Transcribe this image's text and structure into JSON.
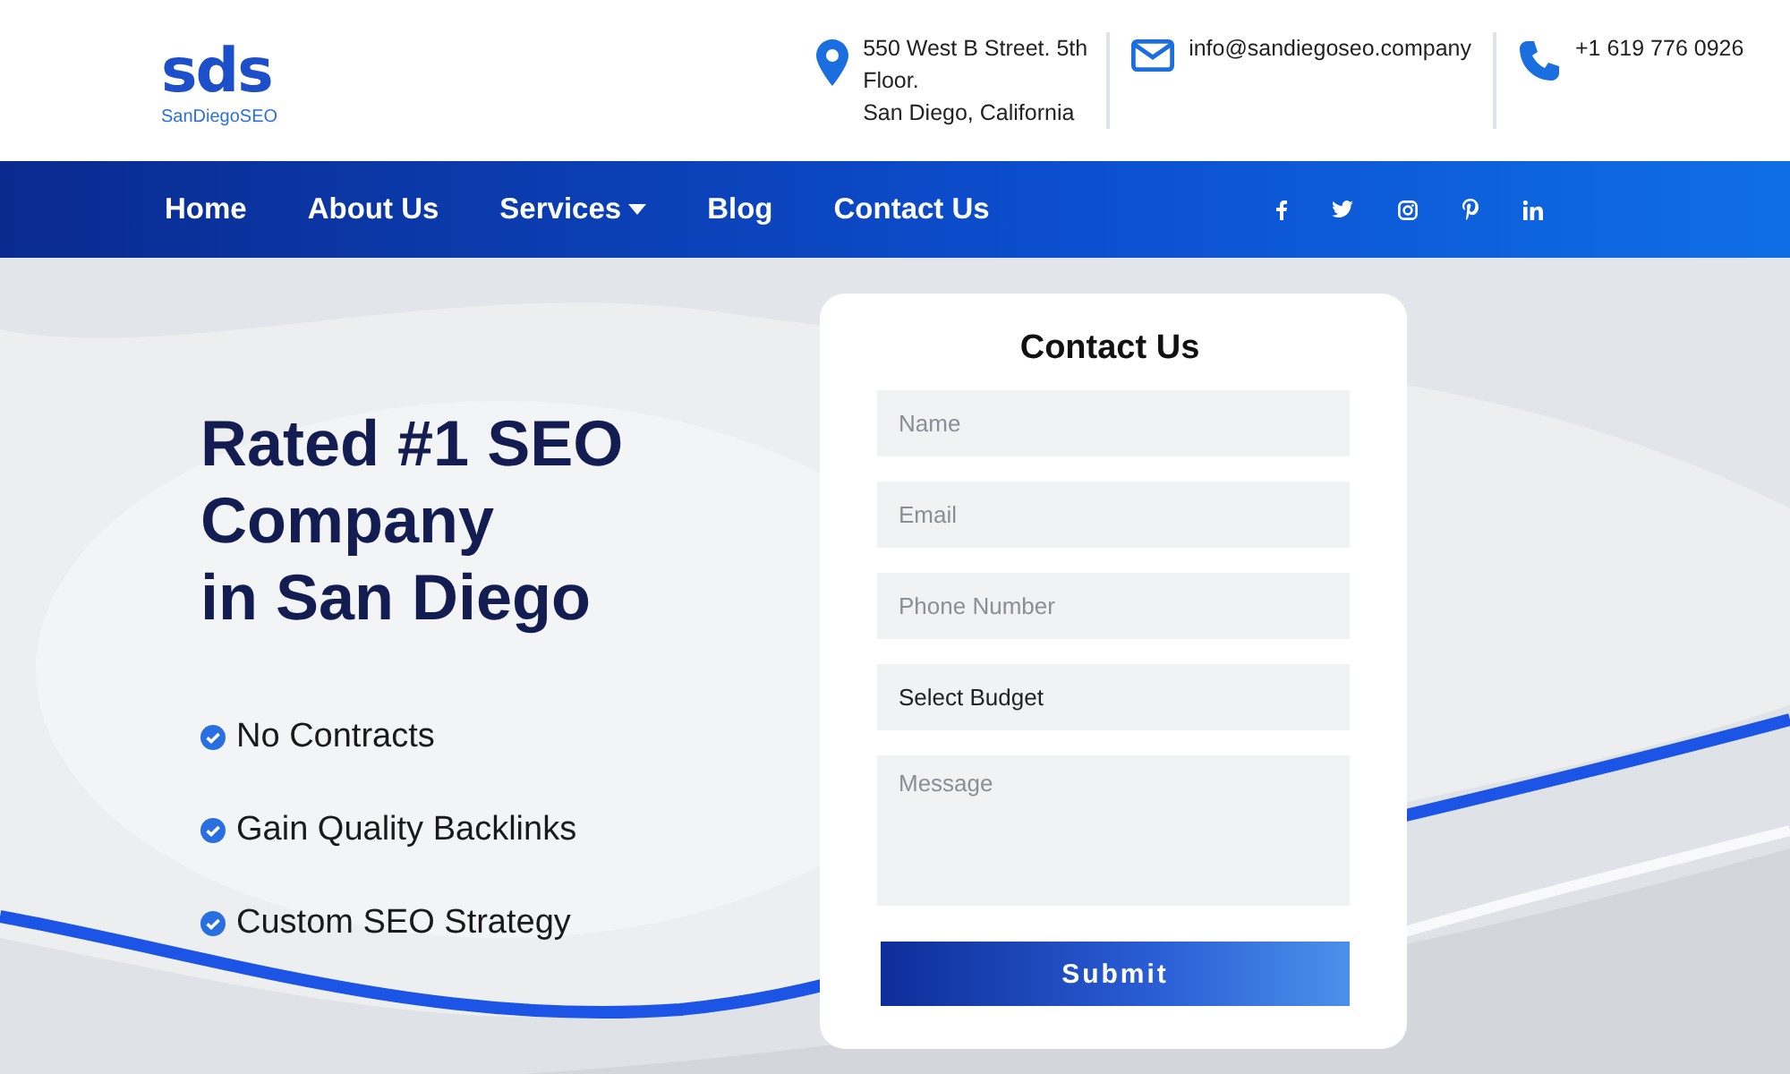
{
  "logo": {
    "mark": "sds",
    "tagline": "SanDiegoSEO"
  },
  "contacts": [
    {
      "kind": "address",
      "lines": [
        "550 West B Street. 5th",
        "Floor.",
        "San Diego, California"
      ]
    },
    {
      "kind": "email",
      "lines": [
        "info@sandiegoseo.company"
      ]
    },
    {
      "kind": "phone",
      "lines": [
        "+1 619 776 0926"
      ]
    }
  ],
  "nav": {
    "items": [
      {
        "label": "Home",
        "has_menu": false
      },
      {
        "label": "About Us",
        "has_menu": false
      },
      {
        "label": "Services",
        "has_menu": true
      },
      {
        "label": "Blog",
        "has_menu": false
      },
      {
        "label": "Contact Us",
        "has_menu": false
      }
    ],
    "social": [
      {
        "kind": "facebook"
      },
      {
        "kind": "twitter"
      },
      {
        "kind": "instagram"
      },
      {
        "kind": "pinterest"
      },
      {
        "kind": "linkedin"
      }
    ]
  },
  "hero": {
    "heading_lines": [
      "Rated #1 SEO",
      "Company",
      "in San Diego"
    ],
    "features": [
      "No Contracts",
      "Gain Quality Backlinks",
      "Custom SEO Strategy"
    ]
  },
  "form": {
    "title": "Contact Us",
    "fields": [
      {
        "kind": "input",
        "placeholder": "Name"
      },
      {
        "kind": "input",
        "placeholder": "Email"
      },
      {
        "kind": "input",
        "placeholder": "Phone Number"
      },
      {
        "kind": "select",
        "value": "Select Budget"
      },
      {
        "kind": "textarea",
        "placeholder": "Message"
      }
    ],
    "submit": "Submit"
  }
}
